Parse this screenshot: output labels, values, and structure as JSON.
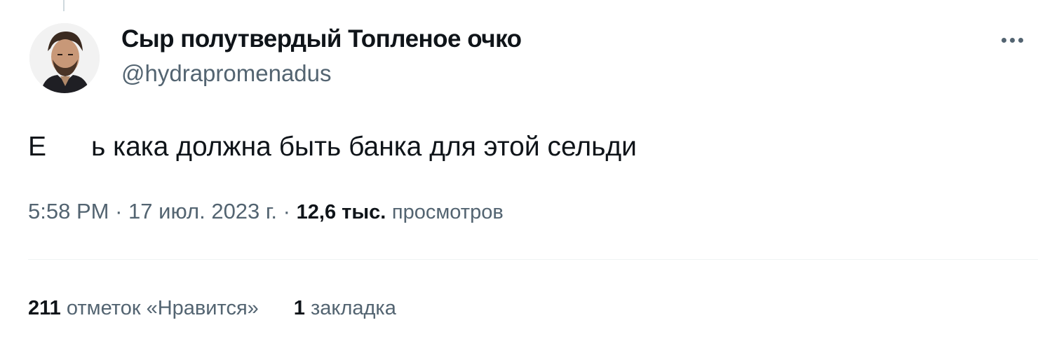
{
  "author": {
    "display_name": "Сыр полутвердый Топленое очко",
    "handle": "@hydrapromenadus"
  },
  "tweet": {
    "text_start": "Е",
    "text_rest": "ь кака должна быть банка для этой сельди"
  },
  "meta": {
    "time": "5:58 PM",
    "separator": "·",
    "date": "17 июл. 2023 г.",
    "views_count": "12,6 тыс.",
    "views_label": "просмотров"
  },
  "stats": {
    "likes_count": "211",
    "likes_label": "отметок «Нравится»",
    "bookmarks_count": "1",
    "bookmarks_label": "закладка"
  },
  "colors": {
    "text_primary": "#0f1419",
    "text_secondary": "#536471",
    "divider": "#eff3f4"
  },
  "icons": {
    "more": "more-horizontal-icon"
  }
}
